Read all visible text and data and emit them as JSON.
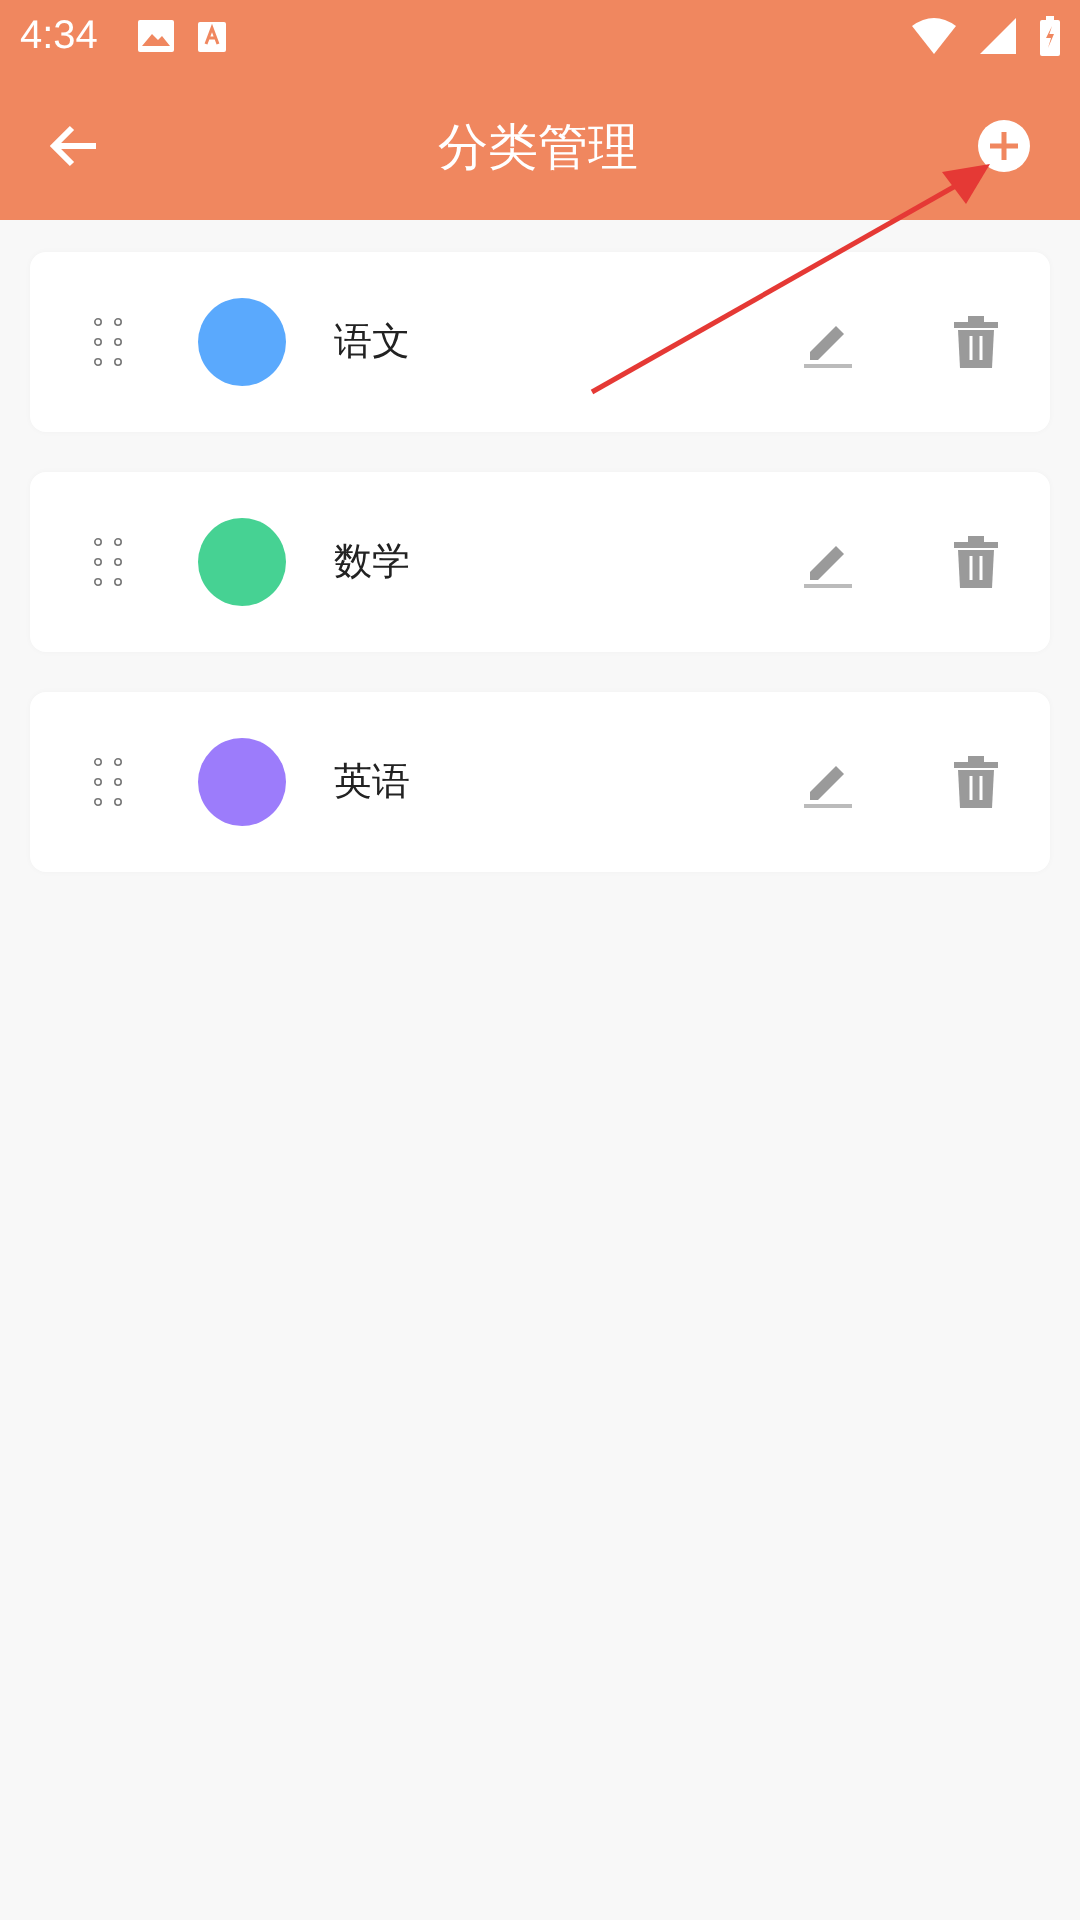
{
  "status_bar": {
    "time": "4:34"
  },
  "app_bar": {
    "title": "分类管理"
  },
  "categories": [
    {
      "name": "语文",
      "color": "#5aa9fd"
    },
    {
      "name": "数学",
      "color": "#46d293"
    },
    {
      "name": "英语",
      "color": "#9c7cfb"
    }
  ]
}
